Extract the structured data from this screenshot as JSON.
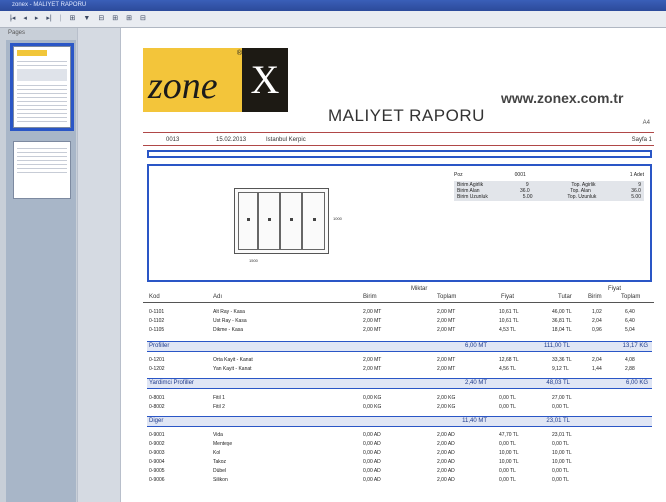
{
  "window": {
    "title": "zonex - MALIYET RAPORU"
  },
  "toolbar": {
    "items": [
      "|◂",
      "◂",
      "▸",
      "▸|",
      "⊞",
      "▼",
      "⊟",
      "⊞",
      "⊞",
      "⊟",
      "▴",
      "▾"
    ]
  },
  "sidebar": {
    "tab_label": "Pages"
  },
  "report": {
    "brand": "zone",
    "brand_x": "X",
    "reg": "®",
    "website": "www.zonex.com.tr",
    "title": "MALIYET RAPORU",
    "paper": "A4",
    "meta_code": "0013",
    "meta_date": "15.02.2013",
    "meta_customer": "Istanbul Kerpic",
    "meta_page": "Sayfa 1"
  },
  "drawing": {
    "width_label": "1500",
    "height_label": "1000",
    "spec": [
      {
        "k": "Poz",
        "v": "0001",
        "k2": "",
        "v2": "1 Adet"
      },
      {
        "k": "Birim Agirlik",
        "v": "9",
        "k2": "Top. Agirlik",
        "v2": "9"
      },
      {
        "k": "Birim Alan",
        "v": "36.0",
        "k2": "Top. Alan",
        "v2": "36.0"
      },
      {
        "k": "Birim Uzunluk",
        "v": "5.00",
        "k2": "Top. Uzunluk",
        "v2": "5.00"
      }
    ]
  },
  "table": {
    "group_header": "Miktar",
    "fiyat_header": "Fiyat",
    "columns": {
      "kod": "Kod",
      "adi": "Adı",
      "birim": "Birim",
      "toplam": "Toplam",
      "fiyat": "Fiyat",
      "tutar": "Tutar",
      "birim2": "Birim",
      "toplam2": "Toplam"
    },
    "rows_a": [
      {
        "kod": "0-1101",
        "adi": "Alt Ray - Kasa",
        "birim": "2,00 MT",
        "toplam": "2,00 MT",
        "fiyat": "10,61 TL",
        "tutar": "46,00 TL",
        "b2": "1,02",
        "t2": "6,40"
      },
      {
        "kod": "0-1102",
        "adi": "Ust Ray - Kasa",
        "birim": "2,00 MT",
        "toplam": "2,00 MT",
        "fiyat": "10,61 TL",
        "tutar": "36,81 TL",
        "b2": "2,04",
        "t2": "6,40"
      },
      {
        "kod": "0-1105",
        "adi": "Dikme - Kasa",
        "birim": "2,00 MT",
        "toplam": "2,00 MT",
        "fiyat": "4,53 TL",
        "tutar": "18,04 TL",
        "b2": "0,96",
        "t2": "5,04"
      }
    ],
    "group_a": {
      "label": "Profiller",
      "toplam": "6,00 MT",
      "tutar": "111,00 TL",
      "extra": "13,17 KG"
    },
    "rows_b": [
      {
        "kod": "0-1201",
        "adi": "Orta Kayit - Kanat",
        "birim": "2,00 MT",
        "toplam": "2,00 MT",
        "fiyat": "12,68 TL",
        "tutar": "33,36 TL",
        "b2": "2,04",
        "t2": "4,08"
      },
      {
        "kod": "0-1202",
        "adi": "Yan Kayit - Kanat",
        "birim": "2,00 MT",
        "toplam": "2,00 MT",
        "fiyat": "4,56 TL",
        "tutar": "9,12 TL",
        "b2": "1,44",
        "t2": "2,88"
      }
    ],
    "group_b": {
      "label": "Yardimci Profiller",
      "toplam": "2,40 MT",
      "tutar": "48,03 TL",
      "extra": "6,00 KG"
    },
    "rows_c": [
      {
        "kod": "0-8001",
        "adi": "Fitil 1",
        "birim": "0,00 KG",
        "toplam": "2,00 KG",
        "fiyat": "0,00 TL",
        "tutar": "27,00 TL",
        "b2": "",
        "t2": ""
      },
      {
        "kod": "0-8002",
        "adi": "Fitil 2",
        "birim": "0,00 KG",
        "toplam": "2,00 KG",
        "fiyat": "0,00 TL",
        "tutar": "0,00 TL",
        "b2": "",
        "t2": ""
      }
    ],
    "group_c": {
      "label": "Diger",
      "toplam": "11,40 MT",
      "tutar": "23,01 TL",
      "extra": ""
    },
    "rows_d": [
      {
        "kod": "0-9001",
        "adi": "Vida",
        "birim": "0,00 AD",
        "toplam": "2,00 AD",
        "fiyat": "47,70 TL",
        "tutar": "23,01 TL"
      },
      {
        "kod": "0-9002",
        "adi": "Menteşe",
        "birim": "0,00 AD",
        "toplam": "2,00 AD",
        "fiyat": "0,00 TL",
        "tutar": "0,00 TL"
      },
      {
        "kod": "0-9003",
        "adi": "Kol",
        "birim": "0,00 AD",
        "toplam": "2,00 AD",
        "fiyat": "10,00 TL",
        "tutar": "10,00 TL"
      },
      {
        "kod": "0-9004",
        "adi": "Takoz",
        "birim": "0,00 AD",
        "toplam": "2,00 AD",
        "fiyat": "10,00 TL",
        "tutar": "10,00 TL"
      },
      {
        "kod": "0-9005",
        "adi": "Dübel",
        "birim": "0,00 AD",
        "toplam": "2,00 AD",
        "fiyat": "0,00 TL",
        "tutar": "0,00 TL"
      },
      {
        "kod": "0-9006",
        "adi": "Silikon",
        "birim": "0,00 AD",
        "toplam": "2,00 AD",
        "fiyat": "0,00 TL",
        "tutar": "0,00 TL"
      }
    ]
  }
}
